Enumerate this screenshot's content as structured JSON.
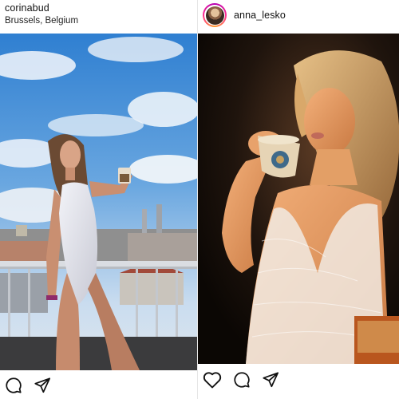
{
  "left_post": {
    "username": "corinabud",
    "location": "Brussels, Belgium",
    "actions": [
      "comment-icon",
      "share-icon"
    ]
  },
  "right_post": {
    "username": "anna_lesko",
    "actions": [
      "like-icon",
      "comment-icon",
      "share-icon"
    ]
  },
  "colors": {
    "text": "#111111",
    "divider": "#e6e6e6",
    "story_ring": [
      "#b300b3",
      "#ff2e93",
      "#ff9d2e"
    ]
  }
}
